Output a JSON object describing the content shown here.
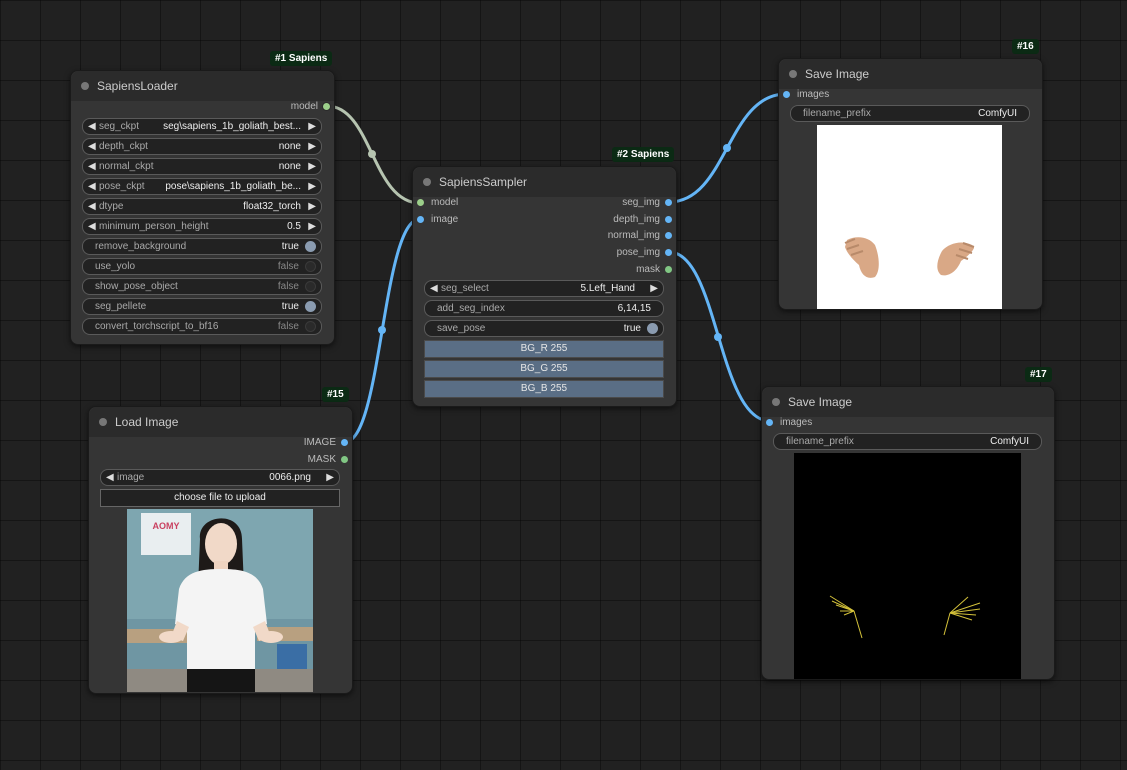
{
  "nodes": {
    "loader": {
      "badge": "#1 Sapiens",
      "title": "SapiensLoader",
      "output": "model",
      "widgets": [
        {
          "label": "seg_ckpt",
          "value": "seg\\sapiens_1b_goliath_best..."
        },
        {
          "label": "depth_ckpt",
          "value": "none"
        },
        {
          "label": "normal_ckpt",
          "value": "none"
        },
        {
          "label": "pose_ckpt",
          "value": "pose\\sapiens_1b_goliath_be..."
        },
        {
          "label": "dtype",
          "value": "float32_torch"
        },
        {
          "label": "minimum_person_height",
          "value": "0.5"
        },
        {
          "label": "remove_background",
          "value": "true"
        },
        {
          "label": "use_yolo",
          "value": "false"
        },
        {
          "label": "show_pose_object",
          "value": "false"
        },
        {
          "label": "seg_pellete",
          "value": "true"
        },
        {
          "label": "convert_torchscript_to_bf16",
          "value": "false"
        }
      ]
    },
    "sampler": {
      "badge": "#2 Sapiens",
      "title": "SapiensSampler",
      "inputs": [
        "model",
        "image"
      ],
      "outputs": [
        "seg_img",
        "depth_img",
        "normal_img",
        "pose_img",
        "mask"
      ],
      "widgets": [
        {
          "label": "seg_select",
          "value": "5.Left_Hand"
        },
        {
          "label": "add_seg_index",
          "value": "6,14,15"
        },
        {
          "label": "save_pose",
          "value": "true"
        }
      ],
      "buttons": [
        "BG_R  255",
        "BG_G  255",
        "BG_B  255"
      ]
    },
    "load_image": {
      "badge": "#15",
      "title": "Load Image",
      "outputs": [
        "IMAGE",
        "MASK"
      ],
      "image_label": "image",
      "image_value": "0066.png",
      "upload_label": "choose file to upload",
      "poster_text": "AOMY"
    },
    "save16": {
      "badge": "#16",
      "title": "Save Image",
      "input": "images",
      "prefix_label": "filename_prefix",
      "prefix_value": "ComfyUI"
    },
    "save17": {
      "badge": "#17",
      "title": "Save Image",
      "input": "images",
      "prefix_label": "filename_prefix",
      "prefix_value": "ComfyUI"
    }
  },
  "colors": {
    "background": "#212121",
    "node": "#353535",
    "node_header": "#2b2b2b",
    "badge": "#0b2a14",
    "model_link": "#b6c4b0",
    "image_link": "#64b5f6",
    "button": "#5a6e85"
  },
  "icons": {
    "left_arrow": "left-arrow-icon",
    "right_arrow": "right-arrow-icon",
    "toggle": "toggle-icon",
    "status_dot": "node-status-dot-icon"
  }
}
